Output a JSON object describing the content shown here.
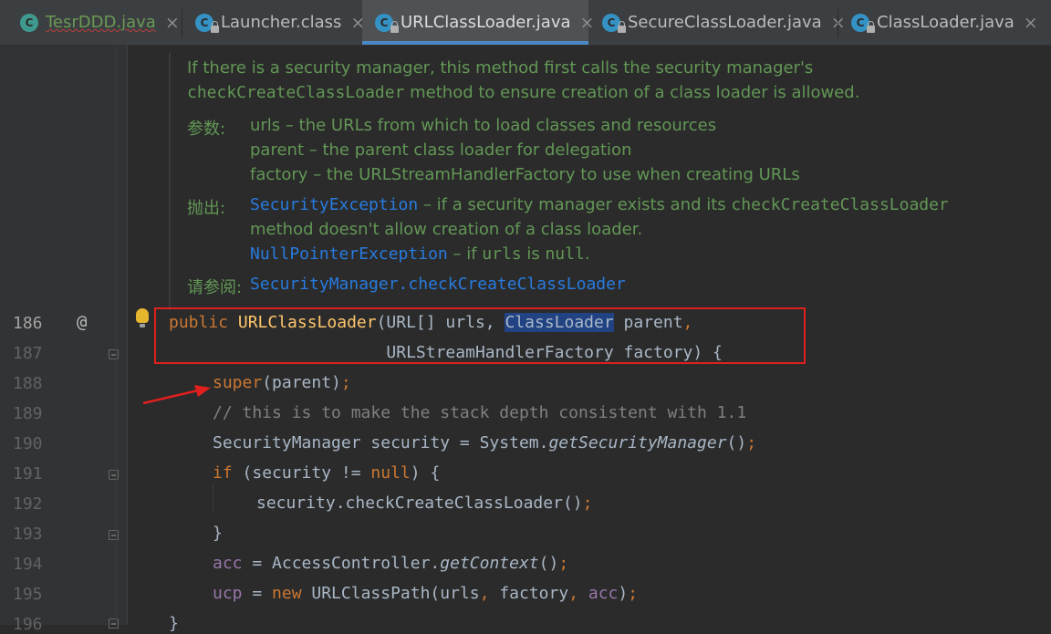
{
  "tabs": [
    {
      "label": "TesrDDD.java",
      "icon": "class-green-icon",
      "has_close": true,
      "error": true
    },
    {
      "label": "Launcher.class",
      "icon": "class-locked-icon",
      "has_close": true
    },
    {
      "label": "URLClassLoader.java",
      "icon": "class-locked-icon",
      "has_close": true,
      "active": true
    },
    {
      "label": "SecureClassLoader.java",
      "icon": "class-locked-icon",
      "has_close": true
    },
    {
      "label": "ClassLoader.java",
      "icon": "class-locked-icon",
      "has_close": true
    }
  ],
  "tab_close_glyph": "×",
  "javadoc": {
    "intro_1": "If there is a security manager, this method first calls the security manager's",
    "intro_2_code": "checkCreateClassLoader",
    "intro_2_text": " method to ensure creation of a class loader is allowed.",
    "params_label": "参数:",
    "params": [
      "urls – the URLs from which to load classes and resources",
      "parent – the parent class loader for delegation",
      "factory – the URLStreamHandlerFactory to use when creating URLs"
    ],
    "throws_label": "抛出:",
    "throws_1_link": "SecurityException",
    "throws_1_text": " – if a security manager exists and its ",
    "throws_1_code": "checkCreateClassLoader",
    "throws_1b": "method doesn't allow creation of a class loader.",
    "throws_2_link": "NullPointerException",
    "throws_2_text_a": " – if ",
    "throws_2_code_a": "urls",
    "throws_2_text_b": " is ",
    "throws_2_code_b": "null",
    "throws_2_text_c": ".",
    "see_label": "请参阅:",
    "see_link": "SecurityManager.checkCreateClassLoader"
  },
  "line_numbers": [
    "186",
    "187",
    "188",
    "189",
    "190",
    "191",
    "192",
    "193",
    "194",
    "195",
    "196"
  ],
  "gutter_at": "@",
  "code": {
    "l186": {
      "kw": "public ",
      "fn": "URLClassLoader",
      "a": "(URL[] urls, ",
      "hl": "ClassLoader",
      "b": " parent",
      "c": ","
    },
    "l187": {
      "a": "                      URLStreamHandlerFactory factory) {"
    },
    "l188": {
      "kw": "super",
      "a": "(parent)",
      "b": ";"
    },
    "l189": {
      "cmt": "// this is to make the stack depth consistent with 1.1"
    },
    "l190": {
      "a": "SecurityManager security = System.",
      "it": "getSecurityManager",
      "b": "()",
      "c": ";"
    },
    "l191": {
      "kw": "if",
      "a": " (security != ",
      "kw2": "null",
      "b": ") {"
    },
    "l192": {
      "a": "security.checkCreateClassLoader()",
      "b": ";"
    },
    "l193": {
      "a": "}"
    },
    "l194": {
      "fld": "acc",
      "a": " = AccessController.",
      "it": "getContext",
      "b": "()",
      "c": ";"
    },
    "l195": {
      "fld": "ucp",
      "a": " = ",
      "kw": "new",
      "b": " URLClassPath(urls",
      "c": ", ",
      "d": "factory",
      "e": ", ",
      "fld2": "acc",
      "f": ")",
      "g": ";"
    },
    "l196": {
      "a": "}"
    }
  },
  "colors": {
    "keyword": "#cc7832",
    "method": "#ffc66d",
    "field": "#9876aa",
    "comment": "#808080",
    "doc": "#629755",
    "link": "#287bde",
    "highlight": "#214283",
    "annotation_box": "#e01f1f"
  }
}
